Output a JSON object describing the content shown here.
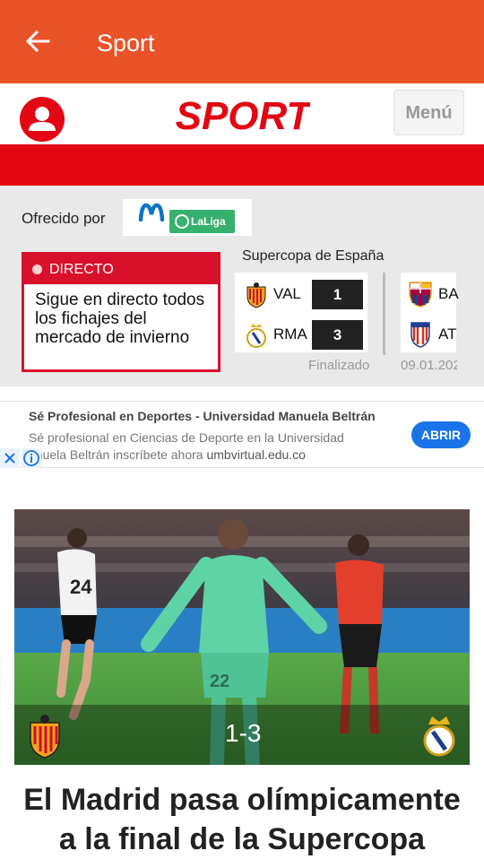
{
  "appbar": {
    "title": "Sport"
  },
  "header": {
    "logo_text": "SPORT",
    "menu_label": "Menú"
  },
  "sponsor": {
    "offered_label": "Ofrecido por",
    "laliga_label": "LaLiga"
  },
  "live": {
    "badge": "DIRECTO",
    "text": "Sigue en directo todos los fichajes del mercado de invierno"
  },
  "competition": {
    "title": "Supercopa de España",
    "match1": {
      "home_abbr": "VAL",
      "home_score": "1",
      "away_abbr": "RMA",
      "away_score": "3",
      "status": "Finalizado"
    },
    "match2": {
      "home_abbr": "BA",
      "away_abbr": "AT",
      "date": "09.01.202"
    }
  },
  "ad": {
    "title": "Sé Profesional en Deportes - Universidad Manuela Beltrán",
    "desc_line1": "Sé profesional en Ciencias de Deporte en la Universidad",
    "desc_line2": "anuela Beltrán inscríbete ahora",
    "url": "umbvirtual.edu.co",
    "cta": "ABRIR"
  },
  "article": {
    "score": "1-3",
    "headline": "El Madrid pasa olímpicamente a la final de la Supercopa"
  },
  "colors": {
    "appbar": "#ea5228",
    "brand_red": "#e30613",
    "live_red": "#d9102b",
    "laliga_green": "#37b06e",
    "ad_blue": "#1a73e8"
  }
}
